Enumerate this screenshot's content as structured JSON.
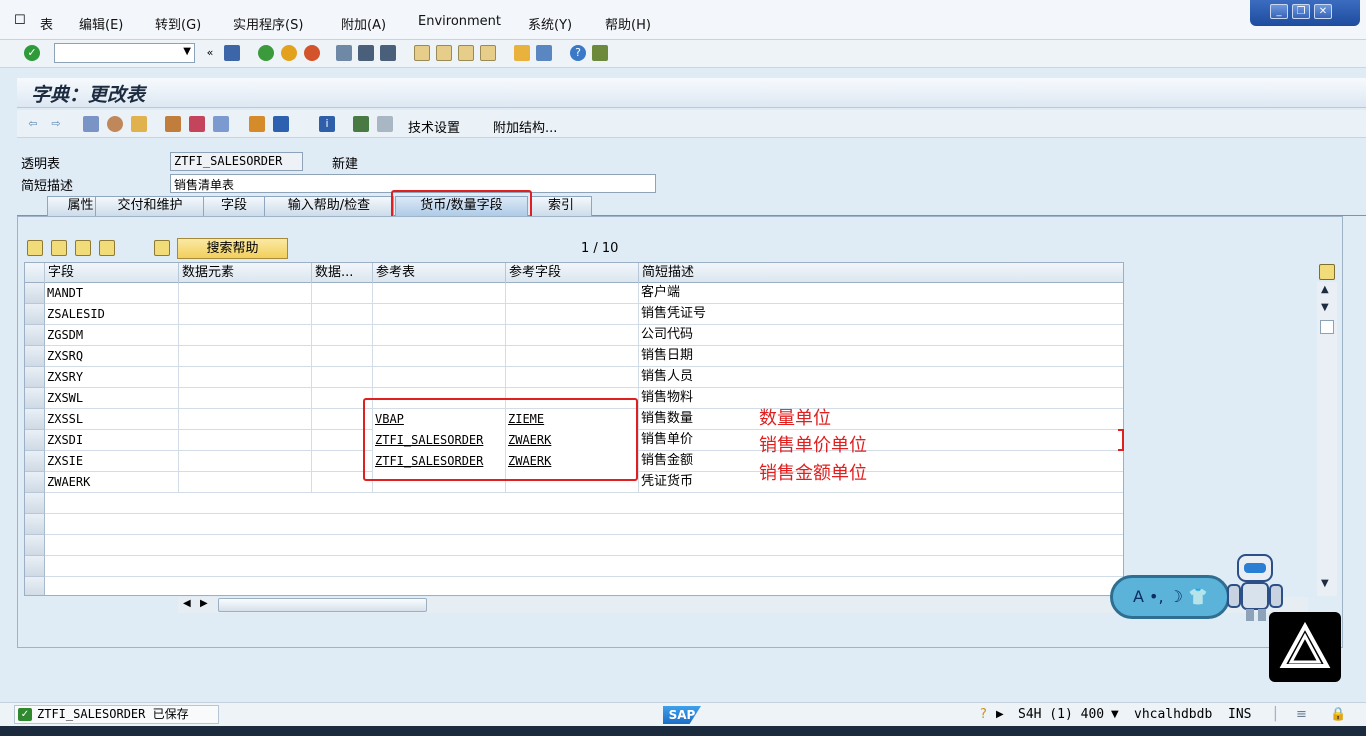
{
  "menu": {
    "items": [
      "表",
      "编辑(E)",
      "转到(G)",
      "实用程序(S)",
      "附加(A)",
      "Environment",
      "系统(Y)",
      "帮助(H)"
    ]
  },
  "window_controls": {
    "minimize": "_",
    "restore": "❐",
    "close": "✕"
  },
  "title": "字典：更改表",
  "app_toolbar": {
    "tech_settings": "技术设置",
    "append_structure": "附加结构..."
  },
  "header": {
    "table_type_label": "透明表",
    "table_name": "ZTFI_SALESORDER",
    "table_state": "新建",
    "short_desc_label": "简短描述",
    "short_desc_value": "销售清单表"
  },
  "tabs": [
    "属性",
    "交付和维护",
    "字段",
    "输入帮助/检查",
    "货币/数量字段",
    "索引"
  ],
  "active_tab": "货币/数量字段",
  "table_toolbar": {
    "search_help": "搜索帮助",
    "pager": "1 / 10"
  },
  "columns": [
    "字段",
    "数据元素",
    "数据...",
    "参考表",
    "参考字段",
    "简短描述"
  ],
  "rows": [
    {
      "field": "MANDT",
      "ref_table": "",
      "ref_field": "",
      "desc": "客户端"
    },
    {
      "field": "ZSALESID",
      "ref_table": "",
      "ref_field": "",
      "desc": "销售凭证号"
    },
    {
      "field": "ZGSDM",
      "ref_table": "",
      "ref_field": "",
      "desc": "公司代码"
    },
    {
      "field": "ZXSRQ",
      "ref_table": "",
      "ref_field": "",
      "desc": "销售日期"
    },
    {
      "field": "ZXSRY",
      "ref_table": "",
      "ref_field": "",
      "desc": "销售人员"
    },
    {
      "field": "ZXSWL",
      "ref_table": "",
      "ref_field": "",
      "desc": "销售物料"
    },
    {
      "field": "ZXSSL",
      "ref_table": "VBAP",
      "ref_field": "ZIEME",
      "desc": "销售数量"
    },
    {
      "field": "ZXSDI",
      "ref_table": "ZTFI_SALESORDER",
      "ref_field": "ZWAERK",
      "desc": "销售单价"
    },
    {
      "field": "ZXSIE",
      "ref_table": "ZTFI_SALESORDER",
      "ref_field": "ZWAERK",
      "desc": "销售金额"
    },
    {
      "field": "ZWAERK",
      "ref_table": "",
      "ref_field": "",
      "desc": "凭证货币"
    }
  ],
  "annotations": [
    "数量单位",
    "销售单价单位",
    "销售金额单位"
  ],
  "mascot": {
    "bubble_text": "A •, ☽ 👕"
  },
  "status": {
    "message": "ZTFI_SALESORDER 已保存",
    "system": "S4H (1) 400",
    "host": "vhcalhdbdb",
    "mode": "INS",
    "sap_logo": "SAP"
  },
  "colors": {
    "accent": "#1c6cc6",
    "highlight": "#e02020",
    "success": "#2f8a2f"
  }
}
